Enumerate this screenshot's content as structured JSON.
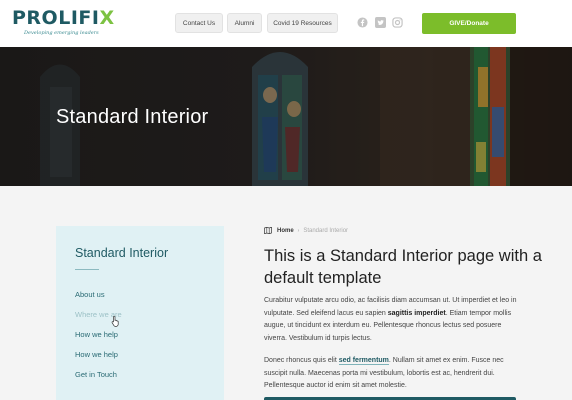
{
  "header": {
    "logo_text_main": "PROLIFI",
    "logo_text_accent": "X",
    "logo_tagline": "Developing emerging leaders",
    "nav": {
      "contact": "Contact Us",
      "alumni": "Alumni",
      "covid": "Covid 19 Resources"
    },
    "social_icons": [
      "facebook-icon",
      "twitter-icon",
      "instagram-icon"
    ],
    "give_label": "GIVE/Donate"
  },
  "hero": {
    "title": "Standard Interior"
  },
  "sidebar": {
    "title": "Standard Interior",
    "links": [
      {
        "label": "About us",
        "muted": false
      },
      {
        "label": "Where we are",
        "muted": true
      },
      {
        "label": "How we help",
        "muted": false
      },
      {
        "label": "How we help",
        "muted": false
      },
      {
        "label": "Get in Touch",
        "muted": false
      }
    ]
  },
  "breadcrumb": {
    "home": "Home",
    "separator": "›",
    "current": "Standard Interior"
  },
  "main": {
    "heading": "This is a Standard Interior page with a default template",
    "para1_before": "Curabitur vulputate arcu odio, ac facilisis diam accumsan ut. Ut imperdiet et leo in vulputate. Sed eleifend lacus eu sapien ",
    "para1_bold": "sagittis imperdiet",
    "para1_after": ". Etiam tempor mollis augue, ut tincidunt ex interdum eu. Pellentesque rhoncus lectus sed posuere viverra. Vestibulum id turpis lectus.",
    "para2_before": "Donec rhoncus quis elit ",
    "para2_link": "sed fermentum",
    "para2_after": ". Nullam sit amet ex enim. Fusce nec suscipit nulla. Maecenas porta mi vestibulum, lobortis est ac, hendrerit dui. Pellentesque auctor id enim sit amet molestie."
  },
  "colors": {
    "brand_teal": "#1f5a63",
    "brand_green": "#7cbd2a",
    "sidebar_bg": "#e0f1f4"
  }
}
